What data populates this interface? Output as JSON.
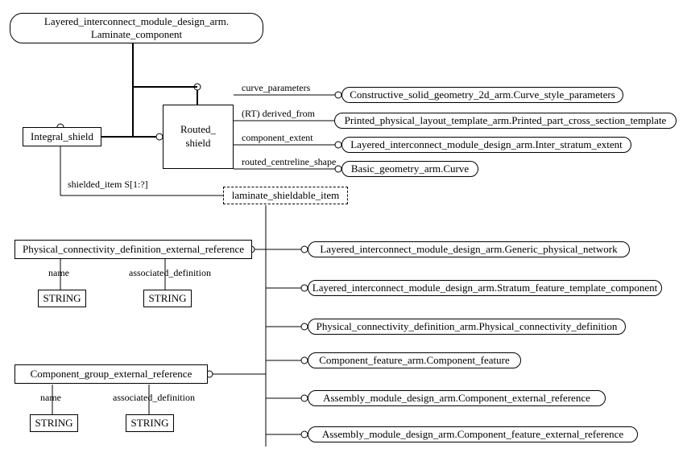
{
  "top_entity": {
    "line1": "Layered_interconnect_module_design_arm.",
    "line2": "Laminate_component"
  },
  "left_entity": "Integral_shield",
  "routed_shield": {
    "line1": "Routed_",
    "line2": "shield"
  },
  "routed_attrs": {
    "curve_parameters": "curve_parameters",
    "derived_from": "(RT) derived_from",
    "component_extent": "component_extent",
    "routed_centreline": "routed_centreline_shape"
  },
  "right_top": [
    "Constructive_solid_geometry_2d_arm.Curve_style_parameters",
    "Printed_physical_layout_template_arm.Printed_part_cross_section_template",
    "Layered_interconnect_module_design_arm.Inter_stratum_extent",
    "Basic_geometry_arm.Curve"
  ],
  "shielded_item": "shielded_item S[1:?]",
  "select_type": "laminate_shieldable_item",
  "pced": {
    "title": "Physical_connectivity_definition_external_reference",
    "name_label": "name",
    "assoc_label": "associated_definition",
    "string": "STRING"
  },
  "cger": {
    "title": "Component_group_external_reference",
    "name_label": "name",
    "assoc_label": "associated_definition",
    "string": "STRING"
  },
  "right_bottom": [
    "Layered_interconnect_module_design_arm.Generic_physical_network",
    "Layered_interconnect_module_design_arm.Stratum_feature_template_component",
    "Physical_connectivity_definition_arm.Physical_connectivity_definition",
    "Component_feature_arm.Component_feature",
    "Assembly_module_design_arm.Component_external_reference",
    "Assembly_module_design_arm.Component_feature_external_reference"
  ]
}
